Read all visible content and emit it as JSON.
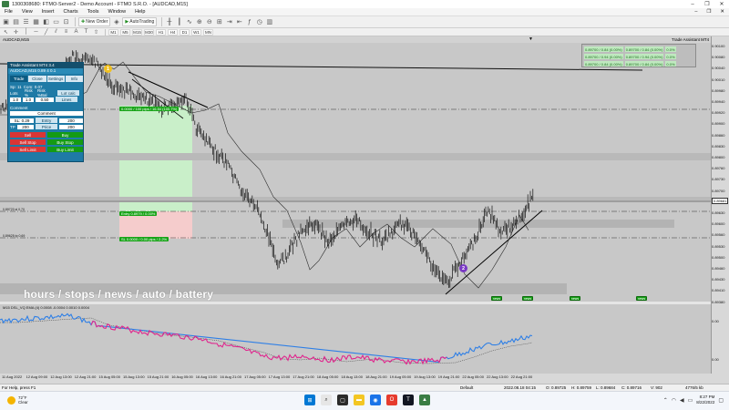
{
  "window": {
    "title": "1300308680: FTMO-Server2 - Demo Account - FTMO S.R.O. - [AUDCAD,M15]",
    "minimize": "–",
    "maximize": "❐",
    "close": "✕"
  },
  "menu": {
    "items": [
      "File",
      "View",
      "Insert",
      "Charts",
      "Tools",
      "Window",
      "Help"
    ],
    "right_icons": [
      "–",
      "❐",
      "✕"
    ]
  },
  "toolbar": {
    "new_order_label": "New Order",
    "autotrading_label": "AutoTrading",
    "periods": [
      "M1",
      "M5",
      "M15",
      "M30",
      "H1",
      "H4",
      "D1",
      "W1",
      "MN"
    ]
  },
  "chart": {
    "symbol_label": "AUDCAD,M15",
    "trade_assistant_label": "Trade Assistant MT4",
    "overlay_text": "hours / stops / news / auto / battery",
    "indicator_header": "M15 DSL_VQ EMA (4) 0.0008 -0.0004 0.0010 0.0004",
    "level_labels": [
      "0.0000 / 100 pips / 16.54 (100.7%)",
      "SL 0.0000 / 0.00 pips / 2.2%",
      "Entry 0.8979 / 0.00%"
    ],
    "left_labels": [
      "0.89720 sl 0.70",
      "0.89625 tp 0.69"
    ],
    "green_pills": [
      "news",
      "news",
      "news",
      "news"
    ],
    "marker_one": "1",
    "marker_two": "2",
    "price_labels": [
      "0.90100",
      "0.90080",
      "0.90040",
      "0.90010",
      "0.89980",
      "0.89940",
      "0.89920",
      "0.89900",
      "0.89860",
      "0.89830",
      "0.89800",
      "0.89760",
      "0.89730",
      "0.89700",
      "0.89660",
      "0.89630",
      "0.89600",
      "0.89560",
      "0.89530",
      "0.89500",
      "0.89460",
      "0.89430",
      "0.89410",
      "0.89380"
    ],
    "current_price": "0.89681",
    "ind_axis_labels": [
      "0.00",
      "0.00"
    ],
    "time_labels": [
      "11 Aug 2022",
      "12 Aug 09:00",
      "12 Aug 13:00",
      "12 Aug 21:00",
      "15 Aug 05:00",
      "15 Aug 13:00",
      "15 Aug 21:00",
      "16 Aug 05:00",
      "16 Aug 13:00",
      "16 Aug 21:00",
      "17 Aug 05:00",
      "17 Aug 13:00",
      "17 Aug 21:00",
      "18 Aug 05:00",
      "18 Aug 13:00",
      "18 Aug 21:00",
      "19 Aug 05:00",
      "19 Aug 13:00",
      "19 Aug 21:00",
      "22 Aug 05:00",
      "22 Aug 13:00",
      "22 Aug 21:00"
    ],
    "colors": {
      "bg": "#c8c8c8",
      "candles": "#111111",
      "ma": "#333333",
      "tp_zone": "#bfe9bf",
      "sl_zone": "#f3c4c4",
      "ind_blue": "#2e7fe6",
      "ind_magenta": "#e0258d"
    }
  },
  "panel": {
    "title": "Trade Assistant MT4 3.4",
    "sub": "AUDCAD,M15  0.89 4  0.1",
    "tabs": [
      "Trade",
      "Close",
      "Settings",
      "Info"
    ],
    "row1": [
      "Sp: 11",
      "Com: 0.07"
    ],
    "row2_labels": [
      "Lots",
      "Risk %",
      "Risk %Bal",
      "Lot calc"
    ],
    "row3_values": [
      "1.0",
      "1.0",
      "0.50",
      "Lines"
    ],
    "comment_label": "Comment",
    "comment_value": "Comment",
    "sl_label": "SL: 0.29",
    "entry_label": "Entry",
    "entry_value": "200",
    "tp_label": "TP",
    "tp_value": "200",
    "price_label": "Price",
    "price_value": "200",
    "sell": "Sell",
    "buy": "Buy",
    "sell_stop": "Sell Stop",
    "buy_stop": "Buy Stop",
    "sell_limit": "Sell Limit",
    "buy_limit": "Buy Limit"
  },
  "ta_widget": {
    "rows": [
      [
        "0.89700 / 0.84 (0.00%)",
        "0.89700 / 0.84 (0.00%)",
        "0.0%"
      ],
      [
        "0.89700 / 0.94 (0.00%)",
        "0.89700 / 0.94 (0.00%)",
        "0.0%"
      ],
      [
        "0.89700 / 0.84 (0.00%)",
        "0.89700 / 0.84 (0.00%)",
        "0.0%"
      ]
    ]
  },
  "statusbar": {
    "help": "For Help, press F1",
    "profile": "Default",
    "datetime": "2022.08.18 04:15",
    "open": "O: 0.89725",
    "high": "H: 0.89759",
    "low": "L: 0.89684",
    "close": "C: 0.89716",
    "volume": "V: 902",
    "traffic": "4776/5 kb"
  },
  "taskbar": {
    "temp": "72°F",
    "condition": "Clear",
    "time": "8:27 PM",
    "date": "8/22/2022"
  }
}
